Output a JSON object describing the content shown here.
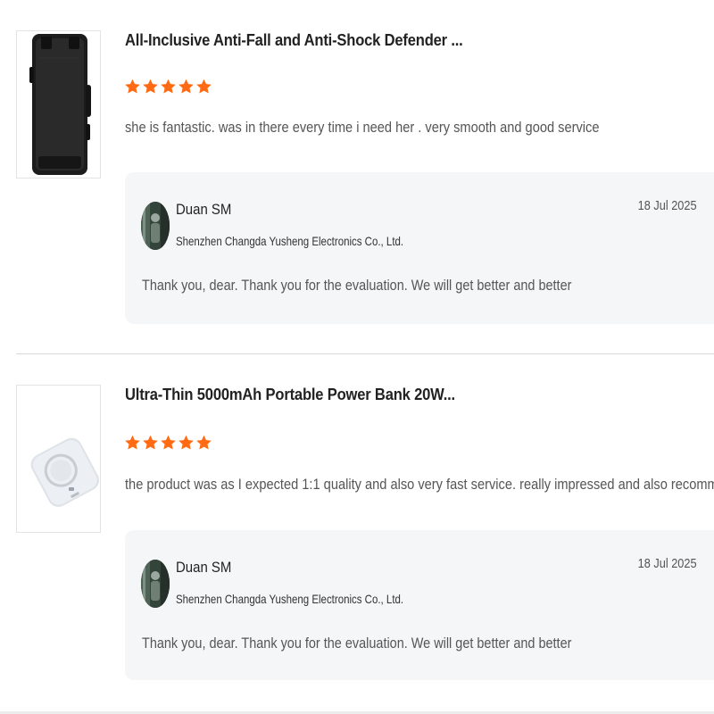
{
  "reviews": [
    {
      "product": {
        "title": "All-Inclusive Anti-Fall and Anti-Shock Defender ...",
        "image_icon": "black-rugged-phone-case"
      },
      "rating": 5,
      "rating_max": 5,
      "comment": "she is fantastic. was in there every time i need her . very smooth and good service",
      "reply": {
        "seller_name": "Duan SM",
        "company": "Shenzhen Changda Yusheng Electronics Co., Ltd.",
        "date": "18 Jul 2025",
        "text": "Thank you, dear. Thank you for the evaluation. We will get better and better"
      }
    },
    {
      "product": {
        "title": "Ultra-Thin 5000mAh Portable Power Bank 20W...",
        "image_icon": "white-magnetic-power-bank"
      },
      "rating": 5,
      "rating_max": 5,
      "comment": "the product was as I expected 1:1 quality and also very fast service. really impressed and also recommend",
      "reply": {
        "seller_name": "Duan SM",
        "company": "Shenzhen Changda Yusheng Electronics Co., Ltd.",
        "date": "18 Jul 2025",
        "text": "Thank you, dear. Thank you for the evaluation. We will get better and better"
      }
    }
  ],
  "colors": {
    "star": "#ff6a13",
    "reply_bg": "#f5f6f8",
    "divider": "#d9d9d9"
  }
}
